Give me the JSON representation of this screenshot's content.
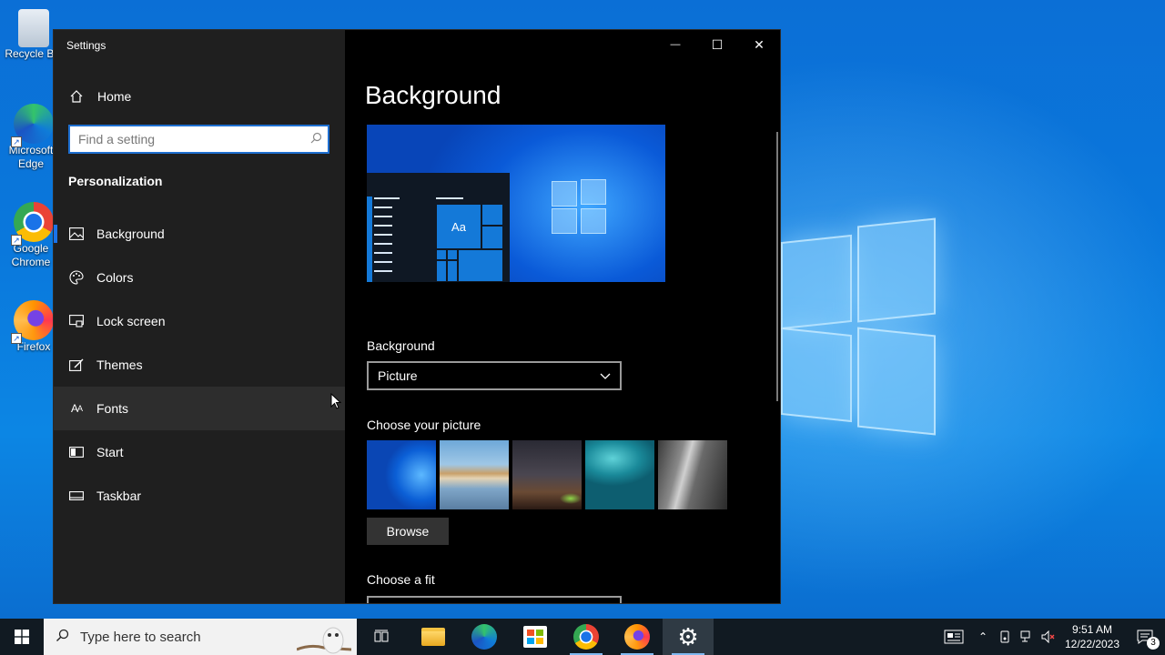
{
  "desktop": {
    "icons": [
      {
        "label": "Recycle Bin",
        "icon": "recycle-bin-icon"
      },
      {
        "label": "Microsoft Edge",
        "icon": "edge-icon"
      },
      {
        "label": "Google Chrome",
        "icon": "chrome-icon"
      },
      {
        "label": "Firefox",
        "icon": "firefox-icon"
      }
    ]
  },
  "window": {
    "title": "Settings",
    "minimize": "—",
    "maximize": "☐",
    "close": "✕"
  },
  "sidebar": {
    "home_label": "Home",
    "search_placeholder": "Find a setting",
    "section_title": "Personalization",
    "items": [
      {
        "label": "Background",
        "icon": "picture-icon"
      },
      {
        "label": "Colors",
        "icon": "palette-icon"
      },
      {
        "label": "Lock screen",
        "icon": "lock-screen-icon"
      },
      {
        "label": "Themes",
        "icon": "themes-icon"
      },
      {
        "label": "Fonts",
        "icon": "fonts-icon"
      },
      {
        "label": "Start",
        "icon": "start-icon"
      },
      {
        "label": "Taskbar",
        "icon": "taskbar-icon"
      }
    ]
  },
  "content": {
    "page_title": "Background",
    "preview_sample_text": "Aa",
    "background_label": "Background",
    "background_value": "Picture",
    "choose_picture_label": "Choose your picture",
    "browse_label": "Browse",
    "choose_fit_label": "Choose a fit"
  },
  "taskbar": {
    "search_placeholder": "Type here to search",
    "apps": [
      "task-view-icon",
      "file-explorer-icon",
      "edge-icon",
      "store-icon",
      "chrome-icon",
      "firefox-icon",
      "settings-icon"
    ],
    "clock_time": "9:51 AM",
    "clock_date": "12/22/2023",
    "notification_count": "3"
  },
  "colors": {
    "accent": "#1a73e8",
    "sidebar_bg": "#1f1f1f",
    "content_bg": "#000000",
    "taskbar_bg": "#111a22"
  }
}
